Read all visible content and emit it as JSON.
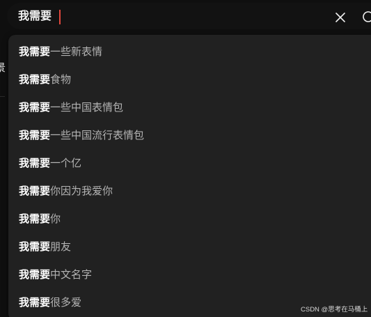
{
  "search": {
    "value": "我需要",
    "clear_icon": "close-icon",
    "search_icon": "search-icon"
  },
  "edge": {
    "partial_text": "景"
  },
  "suggestions": [
    {
      "query": "我需要",
      "completion": "一些新表情"
    },
    {
      "query": "我需要",
      "completion": "食物"
    },
    {
      "query": "我需要",
      "completion": "一些中国表情包"
    },
    {
      "query": "我需要",
      "completion": "一些中国流行表情包"
    },
    {
      "query": "我需要",
      "completion": "一个亿"
    },
    {
      "query": "我需要",
      "completion": "你因为我爱你"
    },
    {
      "query": "我需要",
      "completion": "你"
    },
    {
      "query": "我需要",
      "completion": "朋友"
    },
    {
      "query": "我需要",
      "completion": "中文名字"
    },
    {
      "query": "我需要",
      "completion": "很多爱"
    }
  ],
  "watermark": "CSDN @思考在马桶上",
  "colors": {
    "background": "#0f0f0f",
    "dropdown": "#212121",
    "caret": "#e2483d",
    "completion_text": "#b3b3b3"
  }
}
